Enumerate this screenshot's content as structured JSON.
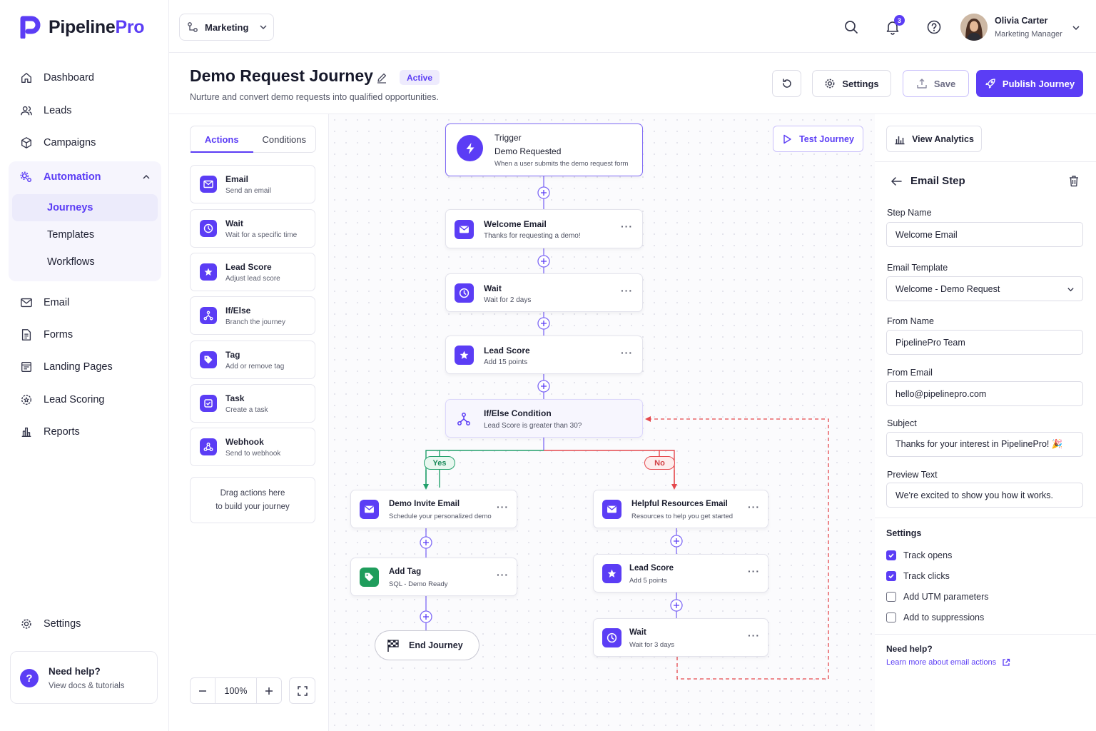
{
  "brand": {
    "name_main": "Pipeline",
    "name_accent": "Pro",
    "accent_color": "#5b3df5"
  },
  "sidebar": {
    "items": [
      {
        "label": "Dashboard",
        "icon": "home-icon"
      },
      {
        "label": "Leads",
        "icon": "users-icon"
      },
      {
        "label": "Campaigns",
        "icon": "cube-icon"
      },
      {
        "label": "Automation",
        "icon": "gears-icon"
      },
      {
        "label": "Email",
        "icon": "mail-icon"
      },
      {
        "label": "Forms",
        "icon": "form-icon"
      },
      {
        "label": "Landing Pages",
        "icon": "layout-icon"
      },
      {
        "label": "Lead Scoring",
        "icon": "gear-star-icon"
      },
      {
        "label": "Reports",
        "icon": "bar-chart-icon"
      }
    ],
    "automation_sub": [
      "Journeys",
      "Templates",
      "Workflows"
    ],
    "settings_label": "Settings",
    "help": {
      "title": "Need help?",
      "subtitle": "View docs & tutorials",
      "icon": "question-icon"
    }
  },
  "topbar": {
    "workspace": "Marketing",
    "notifications_count": "3",
    "user": {
      "name": "Olivia Carter",
      "role": "Marketing Manager"
    }
  },
  "page": {
    "title": "Demo Request Journey",
    "status": "Active",
    "subtitle": "Nurture and convert demo requests into qualified opportunities.",
    "buttons": {
      "settings": "Settings",
      "save": "Save",
      "publish": "Publish Journey"
    }
  },
  "palette": {
    "tabs": [
      "Actions",
      "Conditions"
    ],
    "actions": [
      {
        "title": "Email",
        "subtitle": "Send an email",
        "icon": "mail-icon"
      },
      {
        "title": "Wait",
        "subtitle": "Wait for a specific time",
        "icon": "clock-icon"
      },
      {
        "title": "Lead Score",
        "subtitle": "Adjust lead score",
        "icon": "star-icon"
      },
      {
        "title": "If/Else",
        "subtitle": "Branch the journey",
        "icon": "branch-icon"
      },
      {
        "title": "Tag",
        "subtitle": "Add or remove tag",
        "icon": "tag-icon"
      },
      {
        "title": "Task",
        "subtitle": "Create a task",
        "icon": "task-icon"
      },
      {
        "title": "Webhook",
        "subtitle": "Send to webhook",
        "icon": "webhook-icon"
      }
    ],
    "drop_line1": "Drag actions here",
    "drop_line2": "to build your journey",
    "zoom": "100%"
  },
  "canvas": {
    "test_button": "Test Journey",
    "trigger": {
      "label": "Trigger",
      "title": "Demo Requested",
      "subtitle": "When a user submits the demo request form"
    },
    "welcome": {
      "title": "Welcome Email",
      "subtitle": "Thanks for requesting a demo!"
    },
    "wait1": {
      "title": "Wait",
      "subtitle": "Wait for 2 days"
    },
    "score1": {
      "title": "Lead Score",
      "subtitle": "Add 15 points"
    },
    "condition": {
      "title": "If/Else Condition",
      "subtitle": "Lead Score is greater than 30?"
    },
    "yes_label": "Yes",
    "no_label": "No",
    "demo_invite": {
      "title": "Demo Invite Email",
      "subtitle": "Schedule your personalized demo"
    },
    "add_tag": {
      "title": "Add Tag",
      "subtitle": "SQL - Demo Ready"
    },
    "end": "End Journey",
    "helpful": {
      "title": "Helpful Resources Email",
      "subtitle": "Resources to help you get started"
    },
    "score2": {
      "title": "Lead Score",
      "subtitle": "Add 5 points"
    },
    "wait2": {
      "title": "Wait",
      "subtitle": "Wait for 3 days"
    }
  },
  "panel": {
    "view_analytics": "View Analytics",
    "title": "Email Step",
    "fields": [
      {
        "label": "Step Name",
        "value": "Welcome Email"
      },
      {
        "label": "Email Template",
        "value": "Welcome - Demo Request"
      },
      {
        "label": "From Name",
        "value": "PipelinePro Team"
      },
      {
        "label": "From Email",
        "value": "hello@pipelinepro.com"
      },
      {
        "label": "Subject",
        "value": "Thanks for your interest in PipelinePro! 🎉"
      },
      {
        "label": "Preview Text",
        "value": "We're excited to show you how it works."
      }
    ],
    "settings_title": "Settings",
    "settings": [
      {
        "label": "Track opens",
        "checked": true
      },
      {
        "label": "Track clicks",
        "checked": true
      },
      {
        "label": "Add UTM parameters",
        "checked": false
      },
      {
        "label": "Add to suppressions",
        "checked": false
      }
    ],
    "help_title": "Need help?",
    "help_link": "Learn more about email actions"
  }
}
